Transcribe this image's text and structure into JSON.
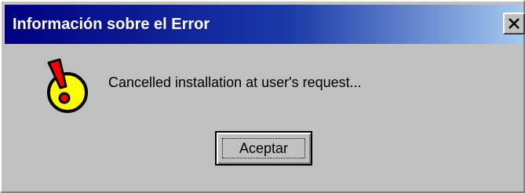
{
  "dialog": {
    "title": "Información sobre el Error",
    "message": "Cancelled installation at user's request...",
    "ok_label": "Aceptar",
    "icon": "warning-exclamation-icon",
    "close_icon": "close-icon"
  },
  "colors": {
    "face": "#c0c0c0",
    "title_start": "#000080",
    "title_end": "#a6caf0",
    "icon_fill": "#ffff00",
    "icon_mark": "#ff0000"
  }
}
